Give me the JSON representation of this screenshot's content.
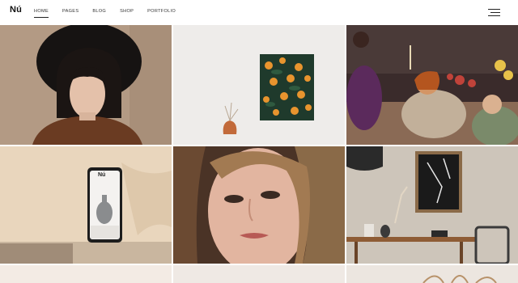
{
  "brand": {
    "logo": "Nú"
  },
  "nav": {
    "items": [
      {
        "label": "HOME",
        "active": true
      },
      {
        "label": "PAGES",
        "active": false
      },
      {
        "label": "BLOG",
        "active": false
      },
      {
        "label": "SHOP",
        "active": false
      },
      {
        "label": "PORTFOLIO",
        "active": false
      }
    ]
  },
  "phone": {
    "logo": "Nú"
  },
  "icons": {
    "menu": "hamburger-menu-icon"
  },
  "colors": {
    "background": "#ffffff",
    "text": "#222222"
  }
}
